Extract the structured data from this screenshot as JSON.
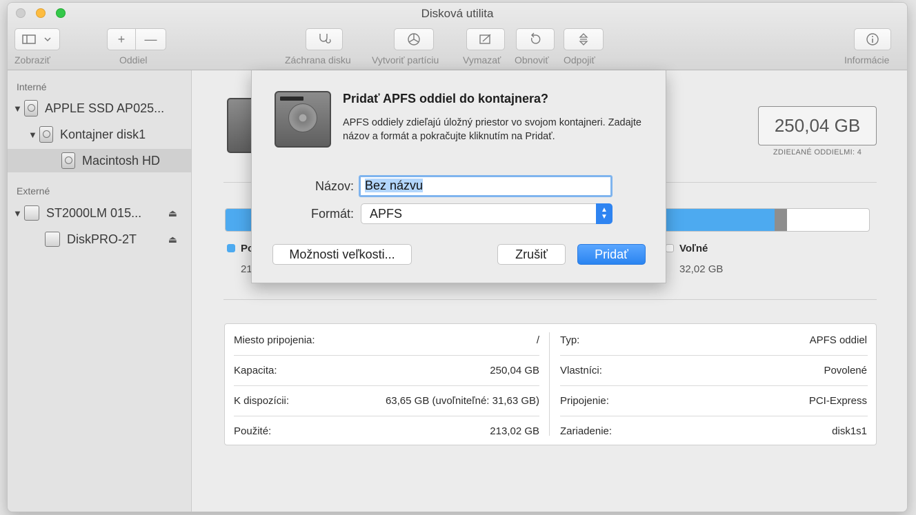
{
  "window": {
    "title": "Disková utilita"
  },
  "toolbar": {
    "view": "Zobraziť",
    "volume": "Oddiel",
    "first_aid": "Záchrana disku",
    "partition": "Vytvoriť partíciu",
    "erase": "Vymazať",
    "restore": "Obnoviť",
    "unmount": "Odpojiť",
    "info": "Informácie"
  },
  "sidebar": {
    "internal_header": "Interné",
    "external_header": "Externé",
    "internal_items": [
      {
        "label": "APPLE SSD AP025..."
      },
      {
        "label": "Kontajner disk1"
      },
      {
        "label": "Macintosh HD"
      }
    ],
    "external_items": [
      {
        "label": "ST2000LM 015..."
      },
      {
        "label": "DiskPRO-2T"
      }
    ]
  },
  "volume": {
    "capacity": "250,04 GB",
    "shared_by": "ZDIEĽANÉ ODDIELMI: 4",
    "used_fraction": 0.853,
    "other_fraction": 0.019,
    "legend_used_label": "Po",
    "legend_used_value": "21",
    "legend_free_label": "Voľné",
    "legend_free_value": "32,02 GB",
    "colors": {
      "used": "#4daaf0",
      "other": "#8e8e8e",
      "free": "#ffffff"
    }
  },
  "info": {
    "left": [
      {
        "label": "Miesto pripojenia:",
        "value": "/"
      },
      {
        "label": "Kapacita:",
        "value": "250,04 GB"
      },
      {
        "label": "K dispozícii:",
        "value": "63,65 GB (uvoľniteľné: 31,63 GB)"
      },
      {
        "label": "Použité:",
        "value": "213,02 GB"
      }
    ],
    "right": [
      {
        "label": "Typ:",
        "value": "APFS oddiel"
      },
      {
        "label": "Vlastníci:",
        "value": "Povolené"
      },
      {
        "label": "Pripojenie:",
        "value": "PCI-Express"
      },
      {
        "label": "Zariadenie:",
        "value": "disk1s1"
      }
    ]
  },
  "dialog": {
    "title": "Pridať APFS oddiel do kontajnera?",
    "description": "APFS oddiely zdieľajú úložný priestor vo svojom kontajneri. Zadajte názov a formát a pokračujte kliknutím na Pridať.",
    "name_label": "Názov:",
    "name_value": "Bez názvu",
    "format_label": "Formát:",
    "format_value": "APFS",
    "size_options": "Možnosti veľkosti...",
    "cancel": "Zrušiť",
    "add": "Pridať"
  }
}
